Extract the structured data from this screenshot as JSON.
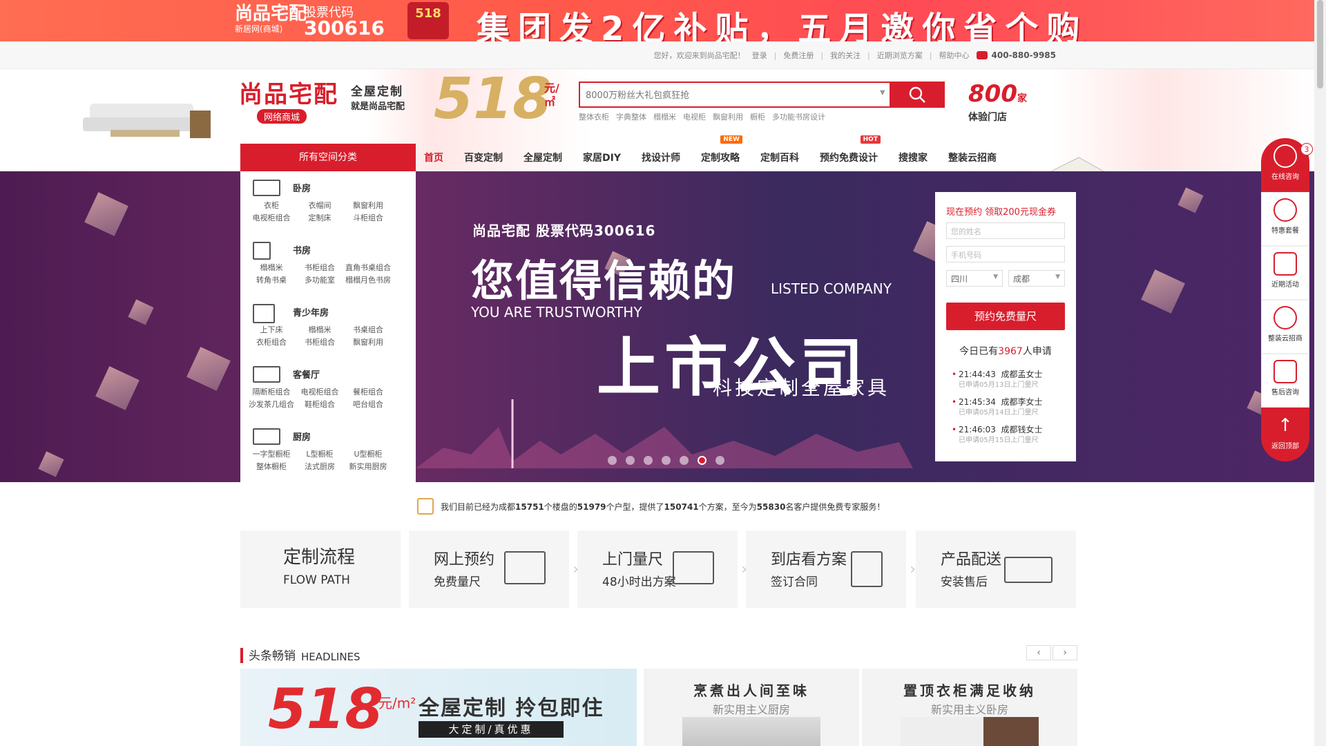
{
  "promo": {
    "brand_line1": "尚品宅配",
    "brand_line2": "新居网(商城)",
    "stock_label": "股票代码",
    "stock_code": "300616",
    "badge": "518",
    "headline": "集团发2亿补贴，五月邀你省个购"
  },
  "topbar": {
    "welcome": "您好，欢迎来到尚品宅配！",
    "login": "登录",
    "register": "免费注册",
    "follow": "我的关注",
    "recent": "近期浏览方案",
    "help": "帮助中心",
    "phone": "400-880-9985"
  },
  "header": {
    "logo_text": "尚品宅配",
    "logo_sub": "网络商城",
    "slogan_a": "全屋定制",
    "slogan_b": "就是尚品宅配",
    "promo_number": "518",
    "promo_unit": "元/㎡",
    "search_placeholder": "8000万粉丝大礼包疯狂抢",
    "hotwords": [
      "整体衣柜",
      "字典整体",
      "榻榻米",
      "电视柜",
      "飘窗利用",
      "橱柜",
      "多功能书房设计"
    ],
    "stores_number": "800",
    "stores_unit": "家",
    "stores_label": "体验门店"
  },
  "nav": {
    "category_button": "所有空间分类",
    "items": [
      {
        "label": "首页"
      },
      {
        "label": "百变定制"
      },
      {
        "label": "全屋定制"
      },
      {
        "label": "家居DIY"
      },
      {
        "label": "找设计师"
      },
      {
        "label": "定制攻略",
        "tag": "NEW"
      },
      {
        "label": "定制百科"
      },
      {
        "label": "预约免费设计",
        "tag": "HOT"
      },
      {
        "label": "搜搜家"
      },
      {
        "label": "整装云招商"
      }
    ]
  },
  "categories": [
    {
      "title": "卧房",
      "subs": [
        "衣柜",
        "衣帽间",
        "飘窗利用",
        "电视柜组合",
        "定制床",
        "斗柜组合"
      ]
    },
    {
      "title": "书房",
      "subs": [
        "榻榻米",
        "书柜组合",
        "直角书桌组合",
        "转角书桌",
        "多功能室",
        "榻榻月色书房"
      ]
    },
    {
      "title": "青少年房",
      "subs": [
        "上下床",
        "榻榻米",
        "书桌组合",
        "衣柜组合",
        "书柜组合",
        "飘窗利用"
      ]
    },
    {
      "title": "客餐厅",
      "subs": [
        "隔断柜组合",
        "电视柜组合",
        "餐柜组合",
        "沙发茶几组合",
        "鞋柜组合",
        "吧台组合"
      ]
    },
    {
      "title": "厨房",
      "subs": [
        "一字型橱柜",
        "L型橱柜",
        "U型橱柜",
        "整体橱柜",
        "法式厨房",
        "新实用厨房"
      ]
    }
  ],
  "slide": {
    "stock_line": "尚品宅配 股票代码300616",
    "main_cn": "您值得信赖的",
    "listed_en": "LISTED COMPANY",
    "trust_en": "YOU ARE TRUSTWORTHY",
    "listed_cn": "上市公司",
    "tagline": "科技定制全屋家具",
    "dot_count": 7,
    "active_dot": 6
  },
  "booking": {
    "title": "现在预约 领取200元现金券",
    "name_placeholder": "您的姓名",
    "phone_placeholder": "手机号码",
    "province": "四川",
    "city": "成都",
    "submit": "预约免费量尺",
    "today_prefix": "今日已有",
    "today_count": "3967",
    "today_suffix": "人申请",
    "records": [
      {
        "time": "21:44:43",
        "who": "成都孟女士",
        "detail": "已申请05月13日上门量尺"
      },
      {
        "time": "21:45:34",
        "who": "成都李女士",
        "detail": "已申请05月14日上门量尺"
      },
      {
        "time": "21:46:03",
        "who": "成都钱女士",
        "detail": "已申请05月15日上门量尺"
      }
    ]
  },
  "sidebar": {
    "consult": "在线咨询",
    "consult_count": "3",
    "package": "特惠套餐",
    "activity": "近期活动",
    "franchise": "整装云招商",
    "aftersale": "售后咨询",
    "top": "返回顶部"
  },
  "stats": {
    "p1": "我们目前已经为成都",
    "buildings": "15751",
    "p2": "个楼盘的",
    "layouts": "51979",
    "p3": "个户型，提供了",
    "plans": "150741",
    "p4": "个方案，至今为",
    "clients": "55830",
    "p5": "名客户提供免费专家服务！"
  },
  "flow": {
    "title_cn": "定制流程",
    "title_en": "FLOW PATH",
    "steps": [
      {
        "l1": "网上预约",
        "l2": "免费量尺"
      },
      {
        "l1": "上门量尺",
        "l2": "48小时出方案"
      },
      {
        "l1": "到店看方案",
        "l2": "签订合同"
      },
      {
        "l1": "产品配送",
        "l2": "安装售后"
      }
    ]
  },
  "headlines": {
    "title_cn": "头条畅销",
    "title_en": "HEADLINES",
    "prev": "‹",
    "next": "›",
    "card1": {
      "number": "518",
      "unit": "元/m²",
      "heading": "全屋定制 拎包即住",
      "tag": "大定制/真优惠"
    },
    "card2": {
      "heading": "烹煮出人间至味",
      "sub": "新实用主义厨房"
    },
    "card3": {
      "heading": "置顶衣柜满足收纳",
      "sub": "新实用主义卧房"
    }
  }
}
